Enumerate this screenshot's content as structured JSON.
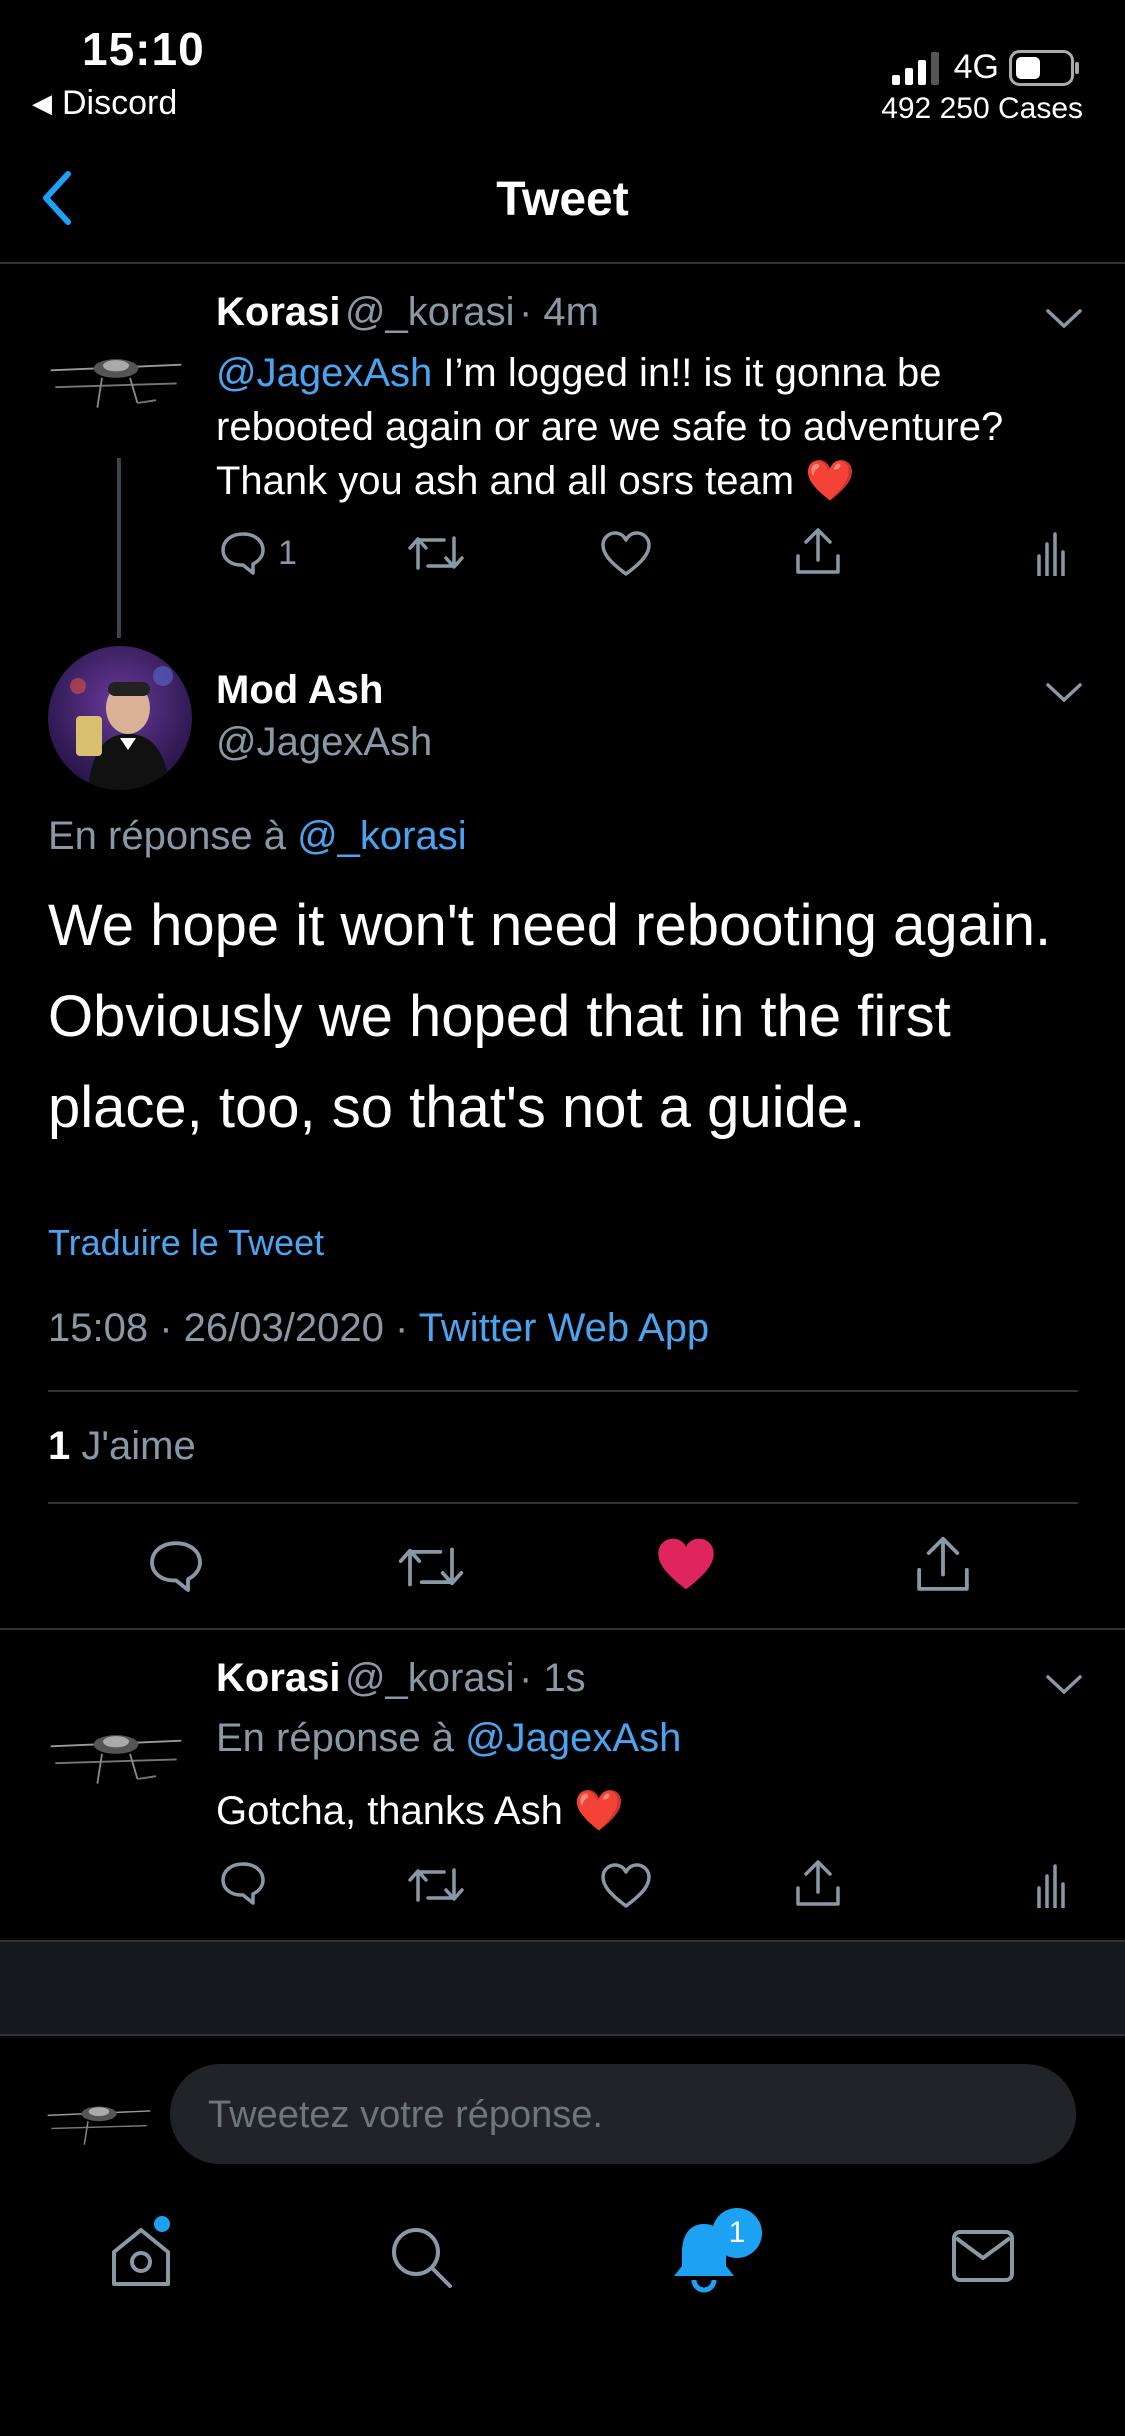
{
  "status_bar": {
    "time": "15:10",
    "back_app": "Discord",
    "network": "4G",
    "cases": "492 250 Cases"
  },
  "nav": {
    "title": "Tweet"
  },
  "tweet1": {
    "name": "Korasi",
    "handle": "@_korasi",
    "time": "· 4m",
    "mention": "@JagexAsh",
    "text": " I’m logged in!! is it gonna be rebooted again or are we safe to adventure? Thank you ash and all osrs team ❤️",
    "reply_count": "1"
  },
  "main_tweet": {
    "name": "Mod Ash",
    "handle": "@JagexAsh",
    "reply_prefix": "En réponse à ",
    "reply_to": "@_korasi",
    "text": "We hope it won't need rebooting again. Obviously we hoped that in the first place, too, so that's not a guide.",
    "translate": "Traduire le Tweet",
    "timestamp": "15:08 · 26/03/2020 · ",
    "source": "Twitter Web App",
    "likes_count": "1",
    "likes_label": " J'aime"
  },
  "tweet3": {
    "name": "Korasi",
    "handle": "@_korasi",
    "time": "· 1s",
    "reply_prefix": "En réponse à ",
    "reply_to": "@JagexAsh",
    "text": "Gotcha, thanks Ash ❤️"
  },
  "composer": {
    "placeholder": "Tweetez votre réponse."
  },
  "tabbar": {
    "notifications_badge": "1"
  },
  "colors": {
    "accent": "#1da1f2",
    "like": "#e0245e",
    "background": "#000000"
  }
}
